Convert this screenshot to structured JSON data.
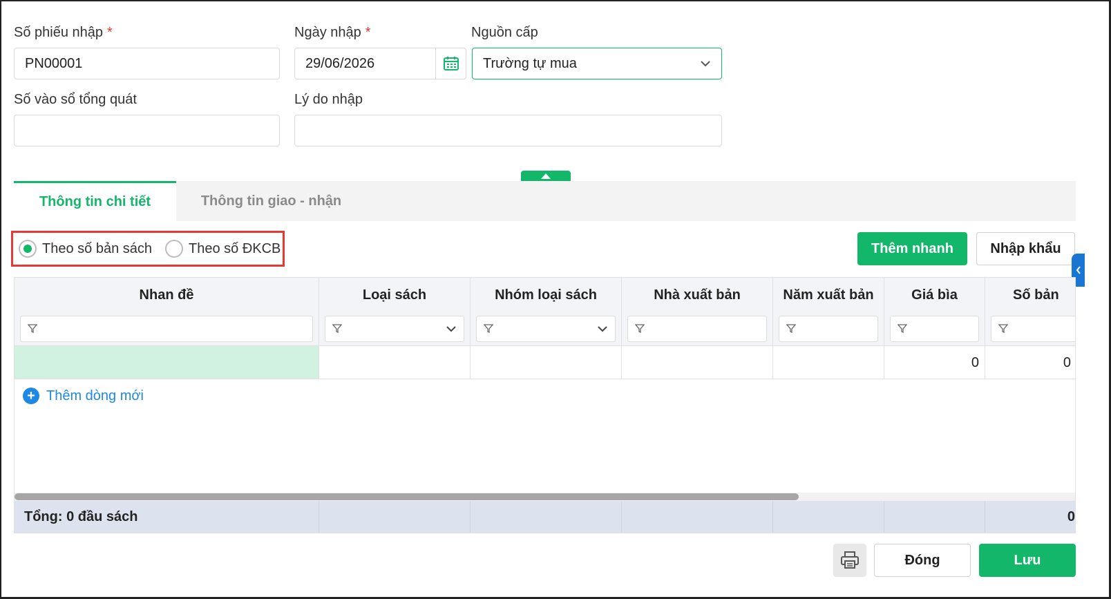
{
  "form": {
    "receipt_no_label": "Số phiếu nhập",
    "receipt_no_value": "PN00001",
    "date_label": "Ngày nhập",
    "date_value": "29/06/2026",
    "source_label": "Nguồn cấp",
    "source_value": "Trường tự mua",
    "ledger_label": "Số vào sổ tổng quát",
    "ledger_value": "",
    "reason_label": "Lý do nhập",
    "reason_value": "",
    "required_mark": "*"
  },
  "tabs": [
    {
      "label": "Thông tin chi tiết",
      "active": true
    },
    {
      "label": "Thông tin giao - nhận",
      "active": false
    }
  ],
  "mode": {
    "option1": "Theo số bản sách",
    "option2": "Theo số ĐKCB",
    "selected": "option1"
  },
  "actions": {
    "quick_add": "Thêm nhanh",
    "import": "Nhập khẩu"
  },
  "table": {
    "columns": [
      "Nhan đề",
      "Loại sách",
      "Nhóm loại sách",
      "Nhà xuất bản",
      "Năm xuất bản",
      "Giá bìa",
      "Số bản"
    ],
    "rows": [
      [
        "",
        "",
        "",
        "",
        "",
        "0",
        "0"
      ]
    ],
    "add_row_label": "Thêm dòng mới",
    "footer_total": "Tổng: 0 đầu sách",
    "footer_last": "0"
  },
  "bottom": {
    "close": "Đóng",
    "save": "Lưu"
  },
  "colors": {
    "accent": "#12b76a",
    "link": "#1e88e5",
    "required": "#e53935",
    "highlight_box": "#e53935"
  },
  "icons": [
    "calendar-icon",
    "chevron-down-icon",
    "chevron-up-icon",
    "filter-icon",
    "plus-icon",
    "printer-icon",
    "chevron-left-icon"
  ]
}
